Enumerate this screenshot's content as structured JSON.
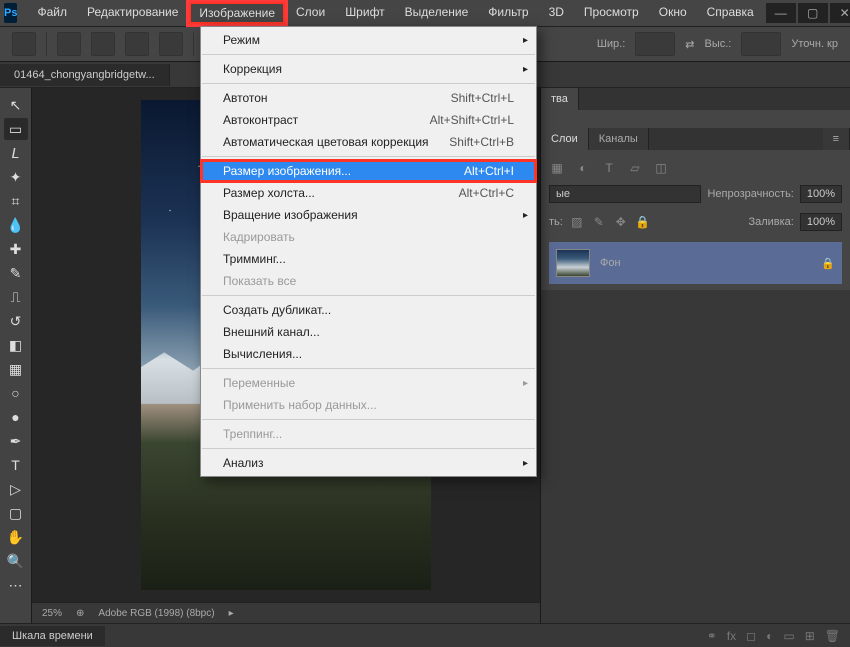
{
  "menubar": {
    "items": [
      "Файл",
      "Редактирование",
      "Изображение",
      "Слои",
      "Шрифт",
      "Выделение",
      "Фильтр",
      "3D",
      "Просмотр",
      "Окно",
      "Справка"
    ],
    "active_index": 2
  },
  "options_bar": {
    "width_label": "Шир.:",
    "height_label": "Выс.:",
    "refine_label": "Уточн. кр"
  },
  "document_tab": "01464_chongyangbridgetw...",
  "canvas_status": {
    "zoom": "25%",
    "profile": "Adobe RGB (1998) (8bpc)"
  },
  "right": {
    "tab_properties": "тва",
    "tab_layers": "Слои",
    "tab_channels": "Каналы",
    "kind_label": "ые",
    "opacity_label": "Непрозрачность:",
    "opacity_value": "100%",
    "fill_label": "Заливка:",
    "fill_value": "100%",
    "lock_label": "ть:",
    "layer_name": "Фон"
  },
  "bottom": {
    "timeline_tab": "Шкала времени"
  },
  "dropdown": {
    "items": [
      {
        "label": "Режим",
        "sub": true
      },
      {
        "sep": true
      },
      {
        "label": "Коррекция",
        "sub": true
      },
      {
        "sep": true
      },
      {
        "label": "Автотон",
        "shortcut": "Shift+Ctrl+L"
      },
      {
        "label": "Автоконтраст",
        "shortcut": "Alt+Shift+Ctrl+L"
      },
      {
        "label": "Автоматическая цветовая коррекция",
        "shortcut": "Shift+Ctrl+B"
      },
      {
        "sep": true
      },
      {
        "label": "Размер изображения...",
        "shortcut": "Alt+Ctrl+I",
        "highlight": true,
        "red": true
      },
      {
        "label": "Размер холста...",
        "shortcut": "Alt+Ctrl+C"
      },
      {
        "label": "Вращение изображения",
        "sub": true
      },
      {
        "label": "Кадрировать",
        "disabled": true
      },
      {
        "label": "Тримминг..."
      },
      {
        "label": "Показать все",
        "disabled": true
      },
      {
        "sep": true
      },
      {
        "label": "Создать дубликат..."
      },
      {
        "label": "Внешний канал..."
      },
      {
        "label": "Вычисления..."
      },
      {
        "sep": true
      },
      {
        "label": "Переменные",
        "sub": true,
        "disabled": true
      },
      {
        "label": "Применить набор данных...",
        "disabled": true
      },
      {
        "sep": true
      },
      {
        "label": "Треппинг...",
        "disabled": true
      },
      {
        "sep": true
      },
      {
        "label": "Анализ",
        "sub": true
      }
    ]
  }
}
